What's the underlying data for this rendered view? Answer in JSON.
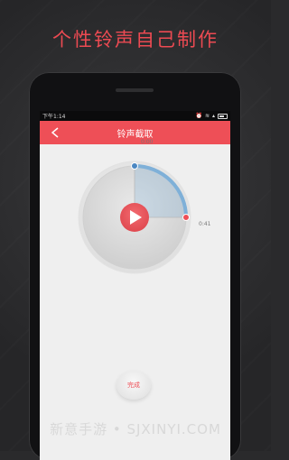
{
  "headline": "个性铃声自己制作",
  "status": {
    "time": "下午1:14"
  },
  "nav": {
    "title": "铃声截取"
  },
  "dial": {
    "start_label": "0:00",
    "end_label": "0:41",
    "progress_fraction": 0.25,
    "accent": "#ee4f57",
    "arc_color": "#7fb0d8"
  },
  "done_button": {
    "label": "完成"
  },
  "watermark": "新意手游 • SJXINYI.COM"
}
